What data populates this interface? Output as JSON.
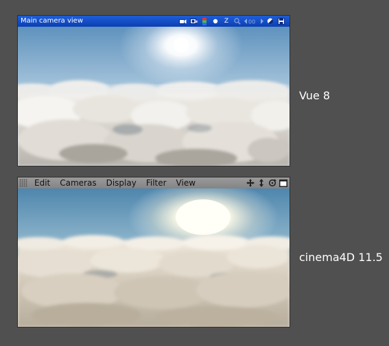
{
  "vue_viewport": {
    "title": "Main camera view",
    "icons": [
      "camera-icon",
      "render-icon",
      "rgb-icon",
      "dot-icon",
      "z-icon",
      "zoom-icon",
      "frame-counter-icon",
      "contrast-icon",
      "save-icon"
    ],
    "counter": "00",
    "titlebar_color": "#0b3fb2"
  },
  "c4d_viewport": {
    "menu": [
      "Edit",
      "Cameras",
      "Display",
      "Filter",
      "View"
    ],
    "nav_icons": [
      "move-icon",
      "dolly-icon",
      "rotate-icon",
      "maximize-icon"
    ]
  },
  "labels": {
    "vue": "Vue 8",
    "c4d": "cinema4D 11.5"
  }
}
